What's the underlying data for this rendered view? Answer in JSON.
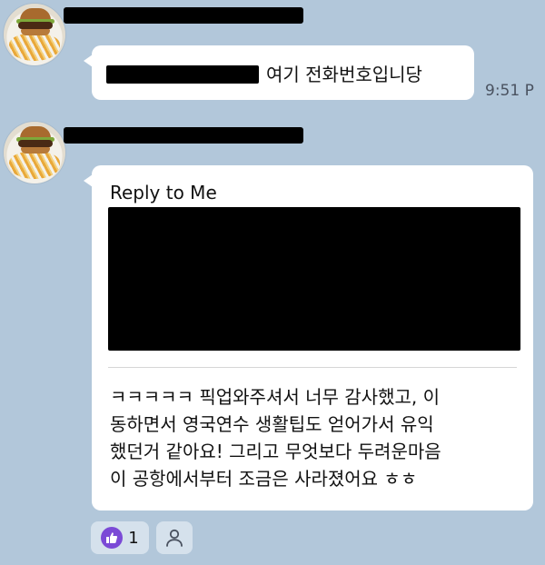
{
  "messages": [
    {
      "sender": {
        "avatar_icon": "burger-fries-avatar-icon",
        "name_redacted": true
      },
      "text": "여기 전화번호입니당",
      "timestamp": "9:51 P"
    },
    {
      "sender": {
        "avatar_icon": "burger-fries-avatar-icon",
        "name_redacted": true
      },
      "reply": {
        "label": "Reply to Me"
      },
      "body_lines": [
        "ㅋㅋㅋㅋㅋ 픽업와주셔서 너무 감사했고, 이",
        "동하면서 영국연수 생활팁도 얻어가서 유익",
        "했던거 같아요! 그리고 무엇보다 두려운마음",
        "이 공항에서부터 조금은 사라졌어요 ㅎㅎ"
      ],
      "reactions": [
        {
          "icon": "thumbs-up-icon",
          "count": "1"
        },
        {
          "icon": "person-icon"
        }
      ]
    }
  ],
  "colors": {
    "background": "#b2c7da",
    "bubble": "#ffffff",
    "like_badge": "#7b4ad6"
  }
}
